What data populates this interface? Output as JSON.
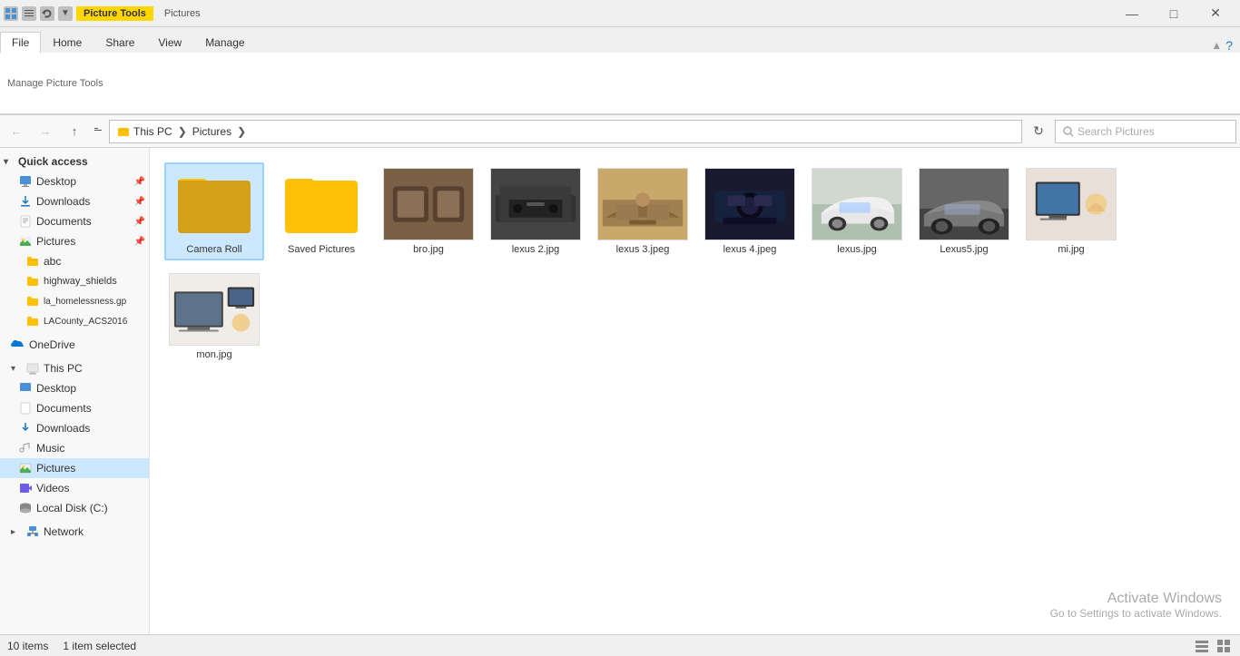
{
  "window": {
    "title": "Pictures",
    "picture_tools_label": "Picture Tools",
    "pictures_label": "Pictures"
  },
  "ribbon": {
    "tabs": [
      "File",
      "Home",
      "Share",
      "View",
      "Manage"
    ],
    "active_tab": "Manage"
  },
  "address_bar": {
    "path_parts": [
      "This PC",
      "Pictures"
    ],
    "search_placeholder": "Search Pictures"
  },
  "sidebar": {
    "quick_access_label": "Quick access",
    "items_quick": [
      {
        "label": "Desktop",
        "pinned": true
      },
      {
        "label": "Downloads",
        "pinned": true
      },
      {
        "label": "Documents",
        "pinned": true
      },
      {
        "label": "Pictures",
        "pinned": true
      }
    ],
    "folders_quick": [
      "abc",
      "highway_shields",
      "la_homelessness.gp",
      "LACounty_ACS2016"
    ],
    "onedrive_label": "OneDrive",
    "this_pc_label": "This PC",
    "items_pc": [
      {
        "label": "Desktop"
      },
      {
        "label": "Documents"
      },
      {
        "label": "Downloads"
      },
      {
        "label": "Music"
      },
      {
        "label": "Pictures",
        "selected": true
      },
      {
        "label": "Videos"
      },
      {
        "label": "Local Disk (C:)"
      }
    ],
    "network_label": "Network"
  },
  "files": [
    {
      "name": "Camera Roll",
      "type": "folder",
      "selected": true
    },
    {
      "name": "Saved Pictures",
      "type": "folder",
      "selected": false
    },
    {
      "name": "bro.jpg",
      "type": "image",
      "thumb": "bro"
    },
    {
      "name": "lexus 2.jpg",
      "type": "image",
      "thumb": "lexus2"
    },
    {
      "name": "lexus 3.jpeg",
      "type": "image",
      "thumb": "lexus3"
    },
    {
      "name": "lexus 4.jpeg",
      "type": "image",
      "thumb": "lexus4"
    },
    {
      "name": "lexus.jpg",
      "type": "image",
      "thumb": "lexus"
    },
    {
      "name": "Lexus5.jpg",
      "type": "image",
      "thumb": "lexus5"
    },
    {
      "name": "mi.jpg",
      "type": "image",
      "thumb": "mi"
    },
    {
      "name": "mon.jpg",
      "type": "image",
      "thumb": "mon"
    }
  ],
  "status": {
    "item_count": "10 items",
    "selected": "1 item selected"
  },
  "watermark": {
    "line1": "Activate Windows",
    "line2": "Go to Settings to activate Windows."
  },
  "window_controls": {
    "minimize": "—",
    "maximize": "□",
    "close": "✕"
  }
}
